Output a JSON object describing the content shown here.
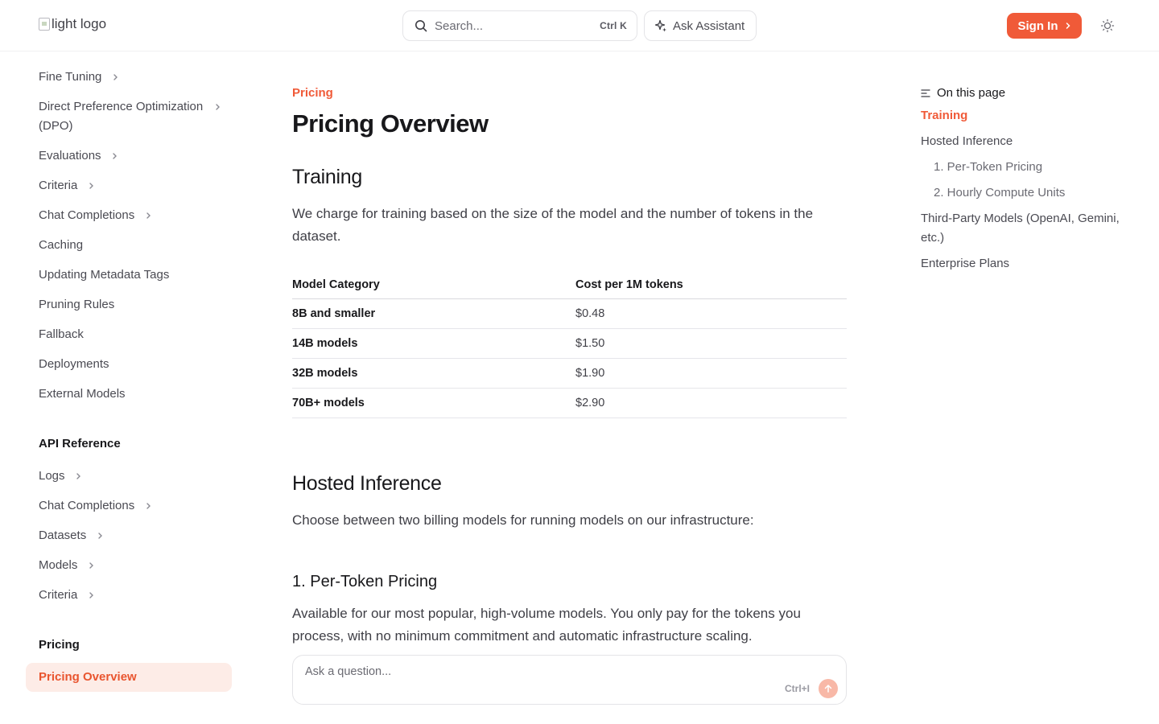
{
  "header": {
    "logo_alt": "light logo",
    "search_placeholder": "Search...",
    "search_shortcut": "Ctrl K",
    "assistant_label": "Ask Assistant",
    "signin_label": "Sign In"
  },
  "sidebar": {
    "items": [
      {
        "label": "Fine Tuning"
      },
      {
        "label": "Direct Preference Optimization (DPO)"
      },
      {
        "label": "Evaluations"
      },
      {
        "label": "Criteria"
      },
      {
        "label": "Chat Completions"
      },
      {
        "label": "Caching"
      },
      {
        "label": "Updating Metadata Tags"
      },
      {
        "label": "Pruning Rules"
      },
      {
        "label": "Fallback"
      },
      {
        "label": "Deployments"
      },
      {
        "label": "External Models"
      }
    ],
    "api_heading": "API Reference",
    "api_items": [
      {
        "label": "Logs"
      },
      {
        "label": "Chat Completions"
      },
      {
        "label": "Datasets"
      },
      {
        "label": "Models"
      },
      {
        "label": "Criteria"
      }
    ],
    "pricing_heading": "Pricing",
    "active_item": "Pricing Overview"
  },
  "main": {
    "eyebrow": "Pricing",
    "title": "Pricing Overview",
    "training": {
      "heading": "Training",
      "description": "We charge for training based on the size of the model and the number of tokens in the dataset.",
      "table": {
        "headers": [
          "Model Category",
          "Cost per 1M tokens"
        ],
        "rows": [
          [
            "8B and smaller",
            "$0.48"
          ],
          [
            "14B models",
            "$1.50"
          ],
          [
            "32B models",
            "$1.90"
          ],
          [
            "70B+ models",
            "$2.90"
          ]
        ]
      }
    },
    "hosted": {
      "heading": "Hosted Inference",
      "description": "Choose between two billing models for running models on our infrastructure:",
      "per_token_heading": "1. Per-Token Pricing",
      "per_token_description": "Available for our most popular, high-volume models. You only pay for the tokens you process, with no minimum commitment and automatic infrastructure scaling."
    },
    "ask_box": {
      "placeholder": "Ask a question...",
      "shortcut": "Ctrl+I"
    }
  },
  "toc": {
    "title": "On this page",
    "items": [
      {
        "label": "Training"
      },
      {
        "label": "Hosted Inference"
      },
      {
        "label": "1. Per-Token Pricing"
      },
      {
        "label": "2. Hourly Compute Units"
      },
      {
        "label": "Third-Party Models (OpenAI, Gemini, etc.)"
      },
      {
        "label": "Enterprise Plans"
      }
    ]
  },
  "colors": {
    "accent": "#f05a38",
    "active_bg": "#fdece7"
  }
}
